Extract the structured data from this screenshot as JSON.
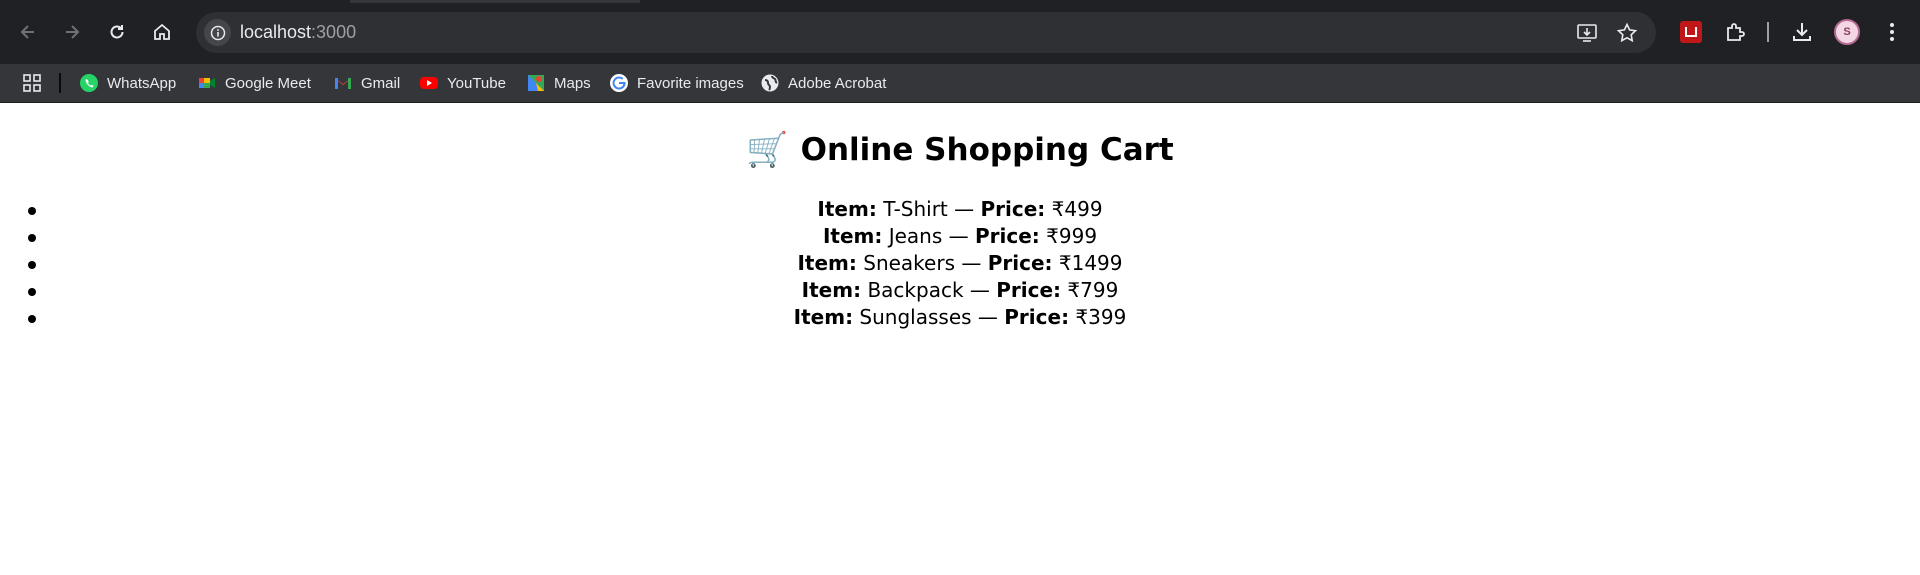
{
  "browser": {
    "url_host": "localhost",
    "url_port": ":3000",
    "bookmarks": [
      {
        "label": "WhatsApp",
        "icon": "whatsapp-icon",
        "color": "#25d366"
      },
      {
        "label": "Google Meet",
        "icon": "google-meet-icon",
        "color": "#00897b"
      },
      {
        "label": "Gmail",
        "icon": "gmail-icon",
        "color": "#ea4335"
      },
      {
        "label": "YouTube",
        "icon": "youtube-icon",
        "color": "#ff0000"
      },
      {
        "label": "Maps",
        "icon": "maps-icon",
        "color": "#34a853"
      },
      {
        "label": "Favorite images",
        "icon": "google-icon",
        "color": "#4285f4"
      },
      {
        "label": "Adobe Acrobat",
        "icon": "globe-icon",
        "color": "#e8eaed"
      }
    ],
    "profile_initial": "S"
  },
  "page": {
    "title": "Online Shopping Cart",
    "title_icon": "🛒",
    "item_label": "Item:",
    "price_label": "Price:",
    "separator": "—",
    "items": [
      {
        "name": "T-Shirt",
        "price": "₹499"
      },
      {
        "name": "Jeans",
        "price": "₹999"
      },
      {
        "name": "Sneakers",
        "price": "₹1499"
      },
      {
        "name": "Backpack",
        "price": "₹799"
      },
      {
        "name": "Sunglasses",
        "price": "₹399"
      }
    ]
  }
}
